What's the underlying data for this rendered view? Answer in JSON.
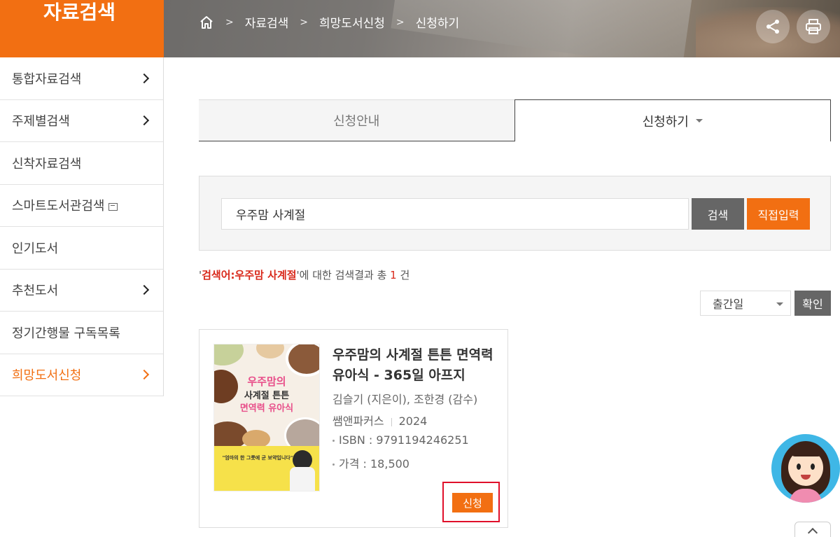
{
  "header": {
    "section_title": "자료검색",
    "breadcrumb": [
      "자료검색",
      "희망도서신청",
      "신청하기"
    ],
    "share_icon": "share-icon",
    "print_icon": "print-icon",
    "home_icon": "home-icon"
  },
  "sidebar": {
    "items": [
      {
        "label": "통합자료검색",
        "has_arrow": true
      },
      {
        "label": "주제별검색",
        "has_arrow": true
      },
      {
        "label": "신착자료검색",
        "has_arrow": false
      },
      {
        "label": "스마트도서관검색",
        "has_arrow": false,
        "external": true
      },
      {
        "label": "인기도서",
        "has_arrow": false
      },
      {
        "label": "추천도서",
        "has_arrow": true
      },
      {
        "label": "정기간행물 구독목록",
        "has_arrow": false
      },
      {
        "label": "희망도서신청",
        "has_arrow": true,
        "active": true
      }
    ]
  },
  "tabs": [
    {
      "label": "신청안내",
      "active": false
    },
    {
      "label": "신청하기",
      "active": true
    }
  ],
  "search": {
    "value": "우주맘 사계절",
    "search_button": "검색",
    "manual_button": "직접입력"
  },
  "result": {
    "keyword_text": "검색어:우주맘 사계절",
    "suffix": "에 대한 검색결과 총",
    "count": "1",
    "unit": "건"
  },
  "sort": {
    "selected": "출간일",
    "confirm_button": "확인"
  },
  "book": {
    "title": "우주맘의 사계절 튼튼 면역력 유아식 - 365일 아프지",
    "authors": "김슬기 (지은이), 조한경 (감수)",
    "publisher": "쌤앤파커스",
    "year": "2024",
    "isbn": "ISBN : 9791194246251",
    "price": "가격 : 18,500",
    "apply_button": "신청",
    "cover": {
      "line1": "우주맘의",
      "line2": "사계절 튼튼",
      "line3": "면역력 유아식",
      "quote": "\"엄마의 한 그릇에 균 보약입니다\""
    }
  },
  "colors": {
    "accent": "#f26f12",
    "highlight_red": "#d9291b",
    "button_gray": "#666666"
  }
}
